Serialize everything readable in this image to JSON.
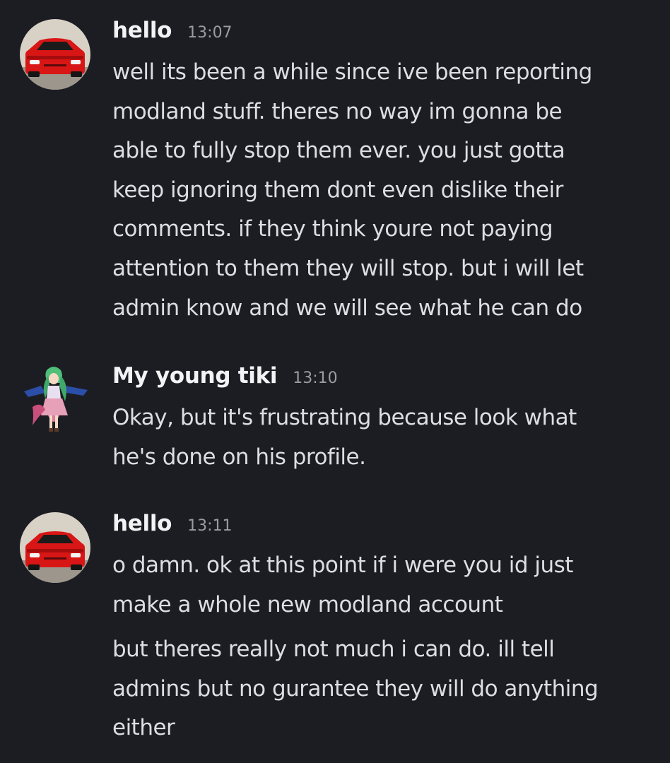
{
  "messages": [
    {
      "username": "hello",
      "timestamp": "13:07",
      "avatar": "red-sports-car",
      "paragraphs": [
        [
          "well its been a while since ive been reporting",
          "modland stuff. theres no way im gonna be",
          "able to fully stop them ever. you just gotta",
          "keep ignoring them dont even dislike their",
          "comments. if they think youre not paying",
          "attention to them they will stop. but i will let",
          "admin know and we will see what he can do"
        ]
      ]
    },
    {
      "username": "My young tiki",
      "timestamp": "13:10",
      "avatar": "anime-character-green-hair",
      "paragraphs": [
        [
          "Okay, but it's frustrating because look what",
          "he's done on his profile."
        ]
      ]
    },
    {
      "username": "hello",
      "timestamp": "13:11",
      "avatar": "red-sports-car",
      "paragraphs": [
        [
          "o damn. ok at this point if i were you id just",
          "make a whole new modland account"
        ],
        [
          "but theres really not much i can do. ill tell",
          "admins but no gurantee they will do anything",
          "either"
        ]
      ]
    }
  ]
}
